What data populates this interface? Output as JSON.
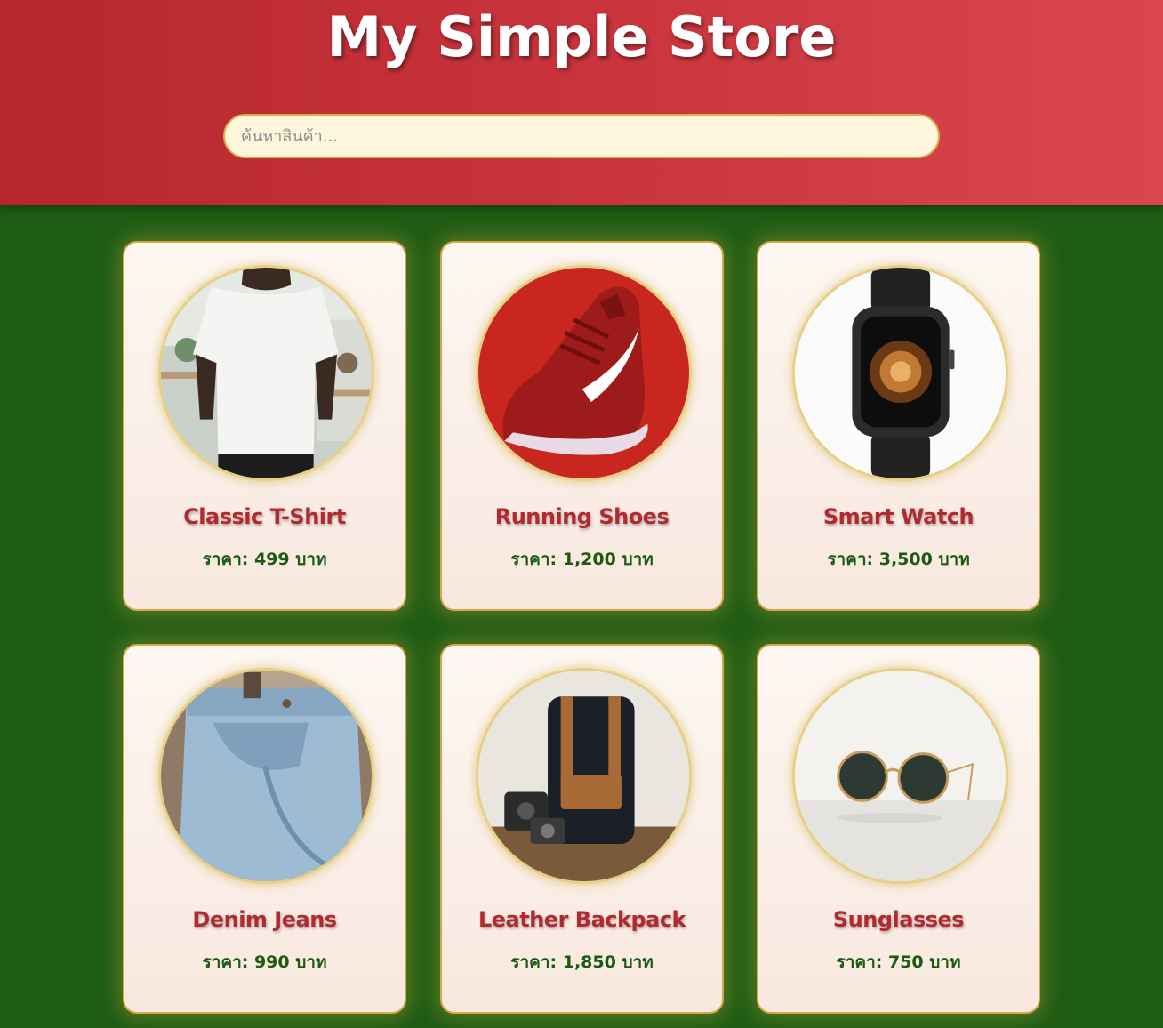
{
  "header": {
    "title": "My Simple Store",
    "search_placeholder": "ค้นหาสินค้า..."
  },
  "products": [
    {
      "name": "Classic T-Shirt",
      "price": "ราคา: 499 บาท",
      "image_icon": "tshirt-photo"
    },
    {
      "name": "Running Shoes",
      "price": "ราคา: 1,200 บาท",
      "image_icon": "shoe-photo"
    },
    {
      "name": "Smart Watch",
      "price": "ราคา: 3,500 บาท",
      "image_icon": "watch-photo"
    },
    {
      "name": "Denim Jeans",
      "price": "ราคา: 990 บาท",
      "image_icon": "jeans-photo"
    },
    {
      "name": "Leather Backpack",
      "price": "ราคา: 1,850 บาท",
      "image_icon": "backpack-photo"
    },
    {
      "name": "Sunglasses",
      "price": "ราคา: 750 บาท",
      "image_icon": "sunglasses-photo"
    }
  ],
  "colors": {
    "header_red": "#c9343c",
    "background_green": "#1f5c14",
    "product_name_red": "#b22a2f",
    "price_green": "#1c5a12",
    "card_border_gold": "#d4a84a",
    "search_bg": "#fdf6dc"
  }
}
